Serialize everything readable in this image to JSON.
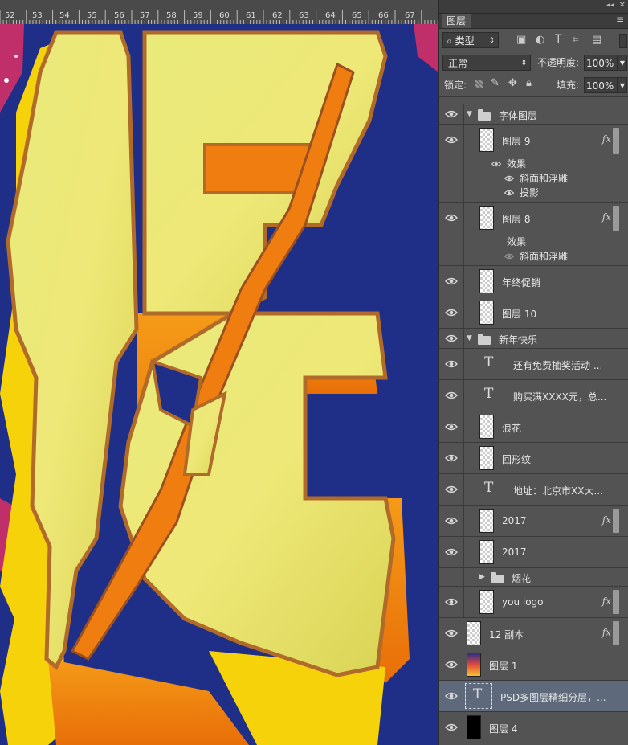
{
  "ruler": {
    "ticks": [
      "52",
      "53",
      "54",
      "55",
      "56",
      "57",
      "58",
      "59",
      "60",
      "61",
      "62",
      "63",
      "64",
      "65",
      "66",
      "67"
    ]
  },
  "panel": {
    "tab_label": "图层",
    "filter_label": "类型",
    "blend_mode": "正常",
    "opacity_label": "不透明度:",
    "opacity_value": "100%",
    "lock_label": "锁定:",
    "fill_label": "填充:",
    "fill_value": "100%",
    "icons": [
      "image-filter-icon",
      "adjustment-filter-icon",
      "type-filter-icon",
      "shape-filter-icon",
      "smart-object-filter-icon"
    ]
  },
  "layers": [
    {
      "name": "字体图层",
      "kind": "group",
      "expanded": true
    },
    {
      "name": "图层 9",
      "kind": "layer",
      "fx": "fx",
      "effects_label": "效果",
      "effects": [
        "斜面和浮雕",
        "投影"
      ]
    },
    {
      "name": "图层 8",
      "kind": "layer",
      "fx": "fx",
      "effects_label": "效果",
      "effects": [
        "斜面和浮雕"
      ]
    },
    {
      "name": "年终促销",
      "kind": "layer"
    },
    {
      "name": "图层 10",
      "kind": "layer"
    },
    {
      "name": "新年快乐",
      "kind": "group",
      "expanded": true
    },
    {
      "name": "还有免费抽奖活动 ...",
      "kind": "text"
    },
    {
      "name": "购买满XXXX元，总...",
      "kind": "text"
    },
    {
      "name": "浪花",
      "kind": "layer"
    },
    {
      "name": "回形纹",
      "kind": "layer"
    },
    {
      "name": "地址：北京市XX大...",
      "kind": "text"
    },
    {
      "name": "2017",
      "kind": "layer",
      "fx": "fx"
    },
    {
      "name": "2017",
      "kind": "layer"
    },
    {
      "name": "烟花",
      "kind": "group",
      "expanded": false
    },
    {
      "name": "you logo",
      "kind": "layer",
      "fx": "fx"
    },
    {
      "name": "12 副本",
      "kind": "layer",
      "fx": "fx"
    },
    {
      "name": "图层 1",
      "kind": "layer"
    },
    {
      "name": "PSD多图层精细分层，...",
      "kind": "text",
      "selected": true
    },
    {
      "name": "图层 4",
      "kind": "layer"
    }
  ],
  "colors": {
    "canvas_bg": "#1f2e86",
    "letter_fill": "#e8e67a",
    "letter_orange": "#f07d10",
    "panel_bg": "#535353",
    "selected_row": "#5e6a7c"
  }
}
